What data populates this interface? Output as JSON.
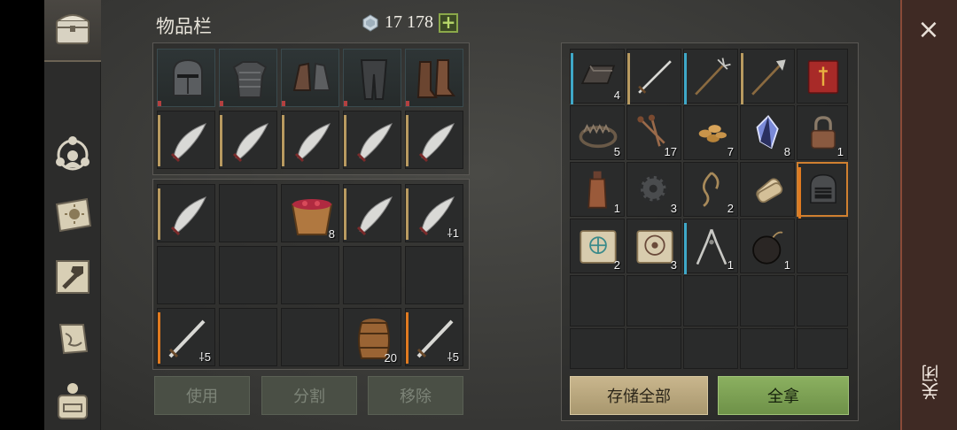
{
  "header": {
    "title": "物品栏",
    "currency_amount": "17 178",
    "plus_label": "+"
  },
  "nav": {
    "items": [
      {
        "name": "chest-icon"
      },
      {
        "name": "character-stats-icon"
      },
      {
        "name": "daily-book-icon"
      },
      {
        "name": "crafting-hammer-icon"
      },
      {
        "name": "quest-scroll-icon"
      },
      {
        "name": "backpack-icon"
      }
    ]
  },
  "equipment": [
    {
      "name": "knight-helmet"
    },
    {
      "name": "chainmail-armor"
    },
    {
      "name": "gauntlets"
    },
    {
      "name": "leg-armor"
    },
    {
      "name": "leather-boots"
    }
  ],
  "hotbar": [
    {
      "name": "scimitar",
      "count": ""
    },
    {
      "name": "scimitar",
      "count": ""
    },
    {
      "name": "scimitar",
      "count": ""
    },
    {
      "name": "scimitar",
      "count": ""
    },
    {
      "name": "scimitar",
      "count": ""
    }
  ],
  "inventory": {
    "row1": [
      {
        "name": "scimitar",
        "count": ""
      },
      {
        "name": "empty",
        "count": ""
      },
      {
        "name": "berry-bowl",
        "count": "8"
      },
      {
        "name": "scimitar",
        "count": ""
      },
      {
        "name": "scimitar",
        "count": "1"
      }
    ],
    "row3": [
      {
        "name": "long-sword",
        "count": "5"
      },
      {
        "name": "barrel",
        "count": "20"
      },
      {
        "name": "long-sword",
        "count": "5"
      }
    ]
  },
  "left_actions": {
    "use": "使用",
    "split": "分割",
    "remove": "移除"
  },
  "storage": {
    "row1": [
      {
        "name": "iron-ingot",
        "count": "4"
      },
      {
        "name": "long-sword",
        "count": ""
      },
      {
        "name": "trident",
        "count": ""
      },
      {
        "name": "halberd",
        "count": ""
      },
      {
        "name": "red-book",
        "count": ""
      }
    ],
    "row2": [
      {
        "name": "bear-trap",
        "count": "5"
      },
      {
        "name": "nails",
        "count": "17"
      },
      {
        "name": "seeds",
        "count": "7"
      },
      {
        "name": "crystal",
        "count": "8"
      },
      {
        "name": "padlock",
        "count": "1"
      }
    ],
    "row3": [
      {
        "name": "bottle",
        "count": "1"
      },
      {
        "name": "gear",
        "count": "3"
      },
      {
        "name": "rope",
        "count": "2"
      },
      {
        "name": "scroll-bundle",
        "count": ""
      },
      {
        "name": "gladiator-helmet",
        "count": ""
      }
    ],
    "row4": [
      {
        "name": "blueprint-scroll",
        "count": "2"
      },
      {
        "name": "recipe-scroll",
        "count": "3"
      },
      {
        "name": "pliers",
        "count": "1"
      },
      {
        "name": "bomb",
        "count": "1"
      }
    ]
  },
  "right_actions": {
    "store_all": "存储全部",
    "take_all": "全拿"
  },
  "close": {
    "x": "×",
    "label": "关闭"
  }
}
